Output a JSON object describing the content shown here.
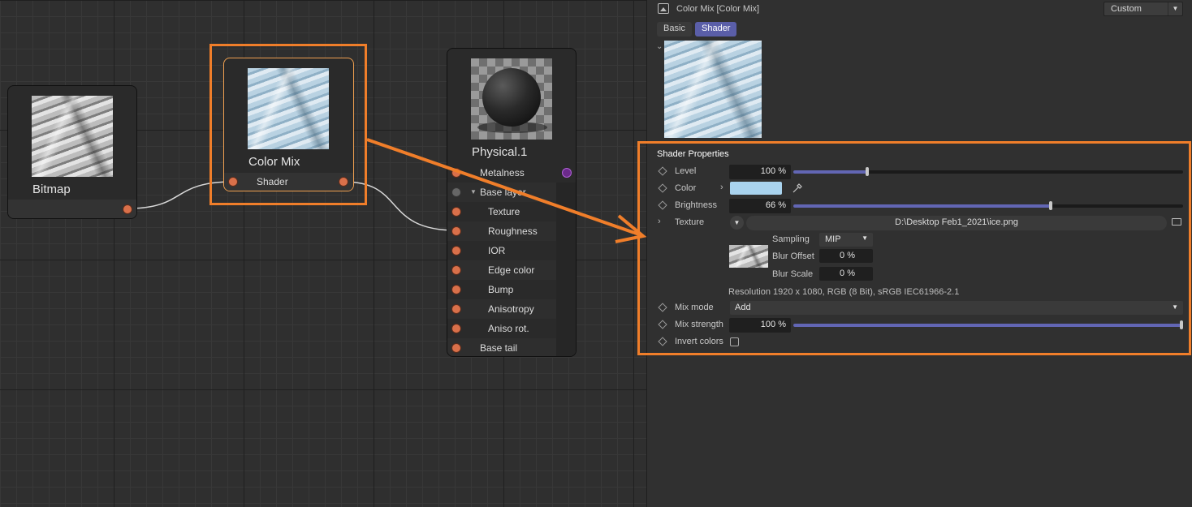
{
  "colors": {
    "accent": "#6266b4",
    "highlight": "#f07e2a",
    "port": "#d9704a",
    "swatch": "#a9d3ee"
  },
  "nodes": {
    "bitmap": {
      "title": "Bitmap"
    },
    "color_mix": {
      "title": "Color Mix",
      "port_label": "Shader"
    },
    "physical": {
      "title": "Physical.1",
      "ports": [
        "Metalness",
        "Base layer",
        "Texture",
        "Roughness",
        "IOR",
        "Edge color",
        "Bump",
        "Anisotropy",
        "Aniso rot.",
        "Base tail"
      ]
    }
  },
  "panel": {
    "header_title": "Color Mix [Color Mix]",
    "preset": "Custom",
    "tabs": {
      "basic": "Basic",
      "shader": "Shader"
    },
    "section_title": "Shader Properties",
    "level": {
      "label": "Level",
      "value": "100 %",
      "fraction": 0.19
    },
    "color": {
      "label": "Color"
    },
    "brightness": {
      "label": "Brightness",
      "value": "66 %",
      "fraction": 0.66
    },
    "texture": {
      "label": "Texture",
      "path": "D:\\Desktop Feb1_2021\\ice.png",
      "sampling_label": "Sampling",
      "sampling_value": "MIP",
      "blur_offset_label": "Blur Offset",
      "blur_offset_value": "0 %",
      "blur_scale_label": "Blur Scale",
      "blur_scale_value": "0 %",
      "resolution": "Resolution 1920 x 1080, RGB (8 Bit), sRGB IEC61966-2.1"
    },
    "mix_mode": {
      "label": "Mix mode",
      "value": "Add"
    },
    "mix_strength": {
      "label": "Mix strength",
      "value": "100 %",
      "fraction": 1.0
    },
    "invert_colors": {
      "label": "Invert colors",
      "checked": false
    }
  }
}
